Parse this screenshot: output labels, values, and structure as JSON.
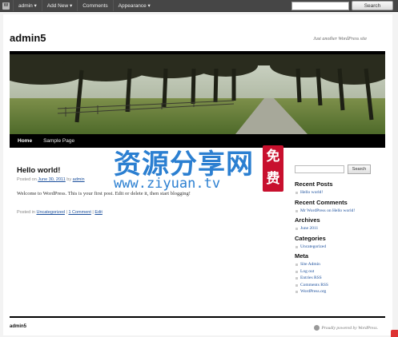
{
  "admin_bar": {
    "items": [
      "admin ▾",
      "Add New ▾",
      "Comments",
      "Appearance ▾"
    ],
    "search_button": "Search"
  },
  "site": {
    "title": "admin5",
    "description": "Just another WordPress site"
  },
  "nav": {
    "items": [
      "Home",
      "Sample Page"
    ]
  },
  "post": {
    "title": "Hello world!",
    "meta_prefix": "Posted on ",
    "date": "June 30, 2011",
    "meta_by": " by ",
    "author": "admin",
    "content": "Welcome to WordPress. This is your first post. Edit or delete it, then start blogging!",
    "footer_prefix": "Posted in ",
    "category": "Uncategorized",
    "separator": " | ",
    "comments_link": "1 Comment",
    "edit_link": "Edit"
  },
  "sidebar": {
    "search_button": "Search",
    "widgets": [
      {
        "title": "Recent Posts",
        "items": [
          "Hello world!"
        ]
      },
      {
        "title": "Recent Comments",
        "items": [
          "Mr WordPress on Hello world!"
        ]
      },
      {
        "title": "Archives",
        "items": [
          "June 2011"
        ]
      },
      {
        "title": "Categories",
        "items": [
          "Uncategorized"
        ]
      },
      {
        "title": "Meta",
        "items": [
          "Site Admin",
          "Log out",
          "Entries RSS",
          "Comments RSS",
          "WordPress.org"
        ]
      }
    ]
  },
  "footer": {
    "site_name": "admin5",
    "credit": "Proudly powered by WordPress."
  },
  "watermark": {
    "main": "资源分享网",
    "url": "www.ziyuan.tv",
    "badge": "免费"
  },
  "colors": {
    "link": "#1b4f9c",
    "admin_bar": "#464646",
    "watermark_blue": "#2b7fd1",
    "watermark_red": "#c8102e"
  }
}
